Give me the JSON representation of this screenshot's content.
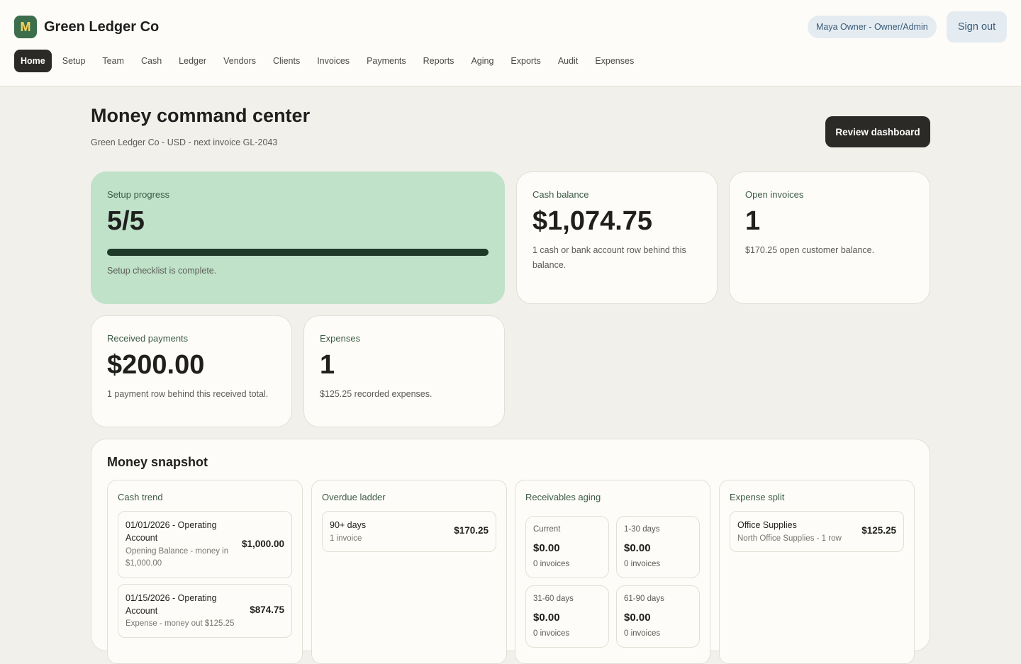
{
  "brand": {
    "initial": "M",
    "name": "Green Ledger Co"
  },
  "user": {
    "label": "Maya Owner - Owner/Admin",
    "signout_label": "Sign out"
  },
  "nav": [
    {
      "label": "Home",
      "active": true
    },
    {
      "label": "Setup"
    },
    {
      "label": "Team"
    },
    {
      "label": "Cash"
    },
    {
      "label": "Ledger"
    },
    {
      "label": "Vendors"
    },
    {
      "label": "Clients"
    },
    {
      "label": "Invoices"
    },
    {
      "label": "Payments"
    },
    {
      "label": "Reports"
    },
    {
      "label": "Aging"
    },
    {
      "label": "Exports"
    },
    {
      "label": "Audit"
    },
    {
      "label": "Expenses"
    }
  ],
  "header": {
    "title": "Money command center",
    "subtitle": "Green Ledger Co - USD - next invoice GL-2043",
    "review_label": "Review dashboard"
  },
  "cards": {
    "setup": {
      "label": "Setup progress",
      "value": "5/5",
      "progress_fraction": 1.0,
      "note": "Setup checklist is complete."
    },
    "cash": {
      "label": "Cash balance",
      "value": "$1,074.75",
      "note": "1 cash or bank account row behind this balance."
    },
    "open_invoices": {
      "label": "Open invoices",
      "value": "1",
      "note": "$170.25 open customer balance."
    },
    "received": {
      "label": "Received payments",
      "value": "$200.00",
      "note": "1 payment row behind this received total."
    },
    "expenses": {
      "label": "Expenses",
      "value": "1",
      "note": "$125.25 recorded expenses."
    }
  },
  "snapshot": {
    "title": "Money snapshot",
    "cash_trend": {
      "title": "Cash trend",
      "rows": [
        {
          "main": "01/01/2026 - Operating Account",
          "sub": "Opening Balance - money in $1,000.00",
          "amount": "$1,000.00"
        },
        {
          "main": "01/15/2026 - Operating Account",
          "sub": "Expense - money out $125.25",
          "amount": "$874.75"
        }
      ]
    },
    "overdue": {
      "title": "Overdue ladder",
      "rows": [
        {
          "main": "90+ days",
          "sub": "1 invoice",
          "amount": "$170.25"
        }
      ]
    },
    "aging": {
      "title": "Receivables aging",
      "buckets": [
        {
          "label": "Current",
          "amount": "$0.00",
          "count": "0 invoices"
        },
        {
          "label": "1-30 days",
          "amount": "$0.00",
          "count": "0 invoices"
        },
        {
          "label": "31-60 days",
          "amount": "$0.00",
          "count": "0 invoices"
        },
        {
          "label": "61-90 days",
          "amount": "$0.00",
          "count": "0 invoices"
        }
      ]
    },
    "expense_split": {
      "title": "Expense split",
      "rows": [
        {
          "main": "Office Supplies",
          "sub": "North Office Supplies - 1 row",
          "amount": "$125.25"
        }
      ]
    }
  }
}
